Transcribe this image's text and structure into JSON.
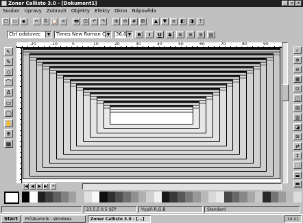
{
  "window": {
    "title": "Zoner Callisto 3.0 - [Dokument1]",
    "buttons": [
      "_",
      "▫",
      "×"
    ]
  },
  "menu": [
    "Soubor",
    "Úpravy",
    "Zobrazit",
    "Objekty",
    "Efekty",
    "Okno",
    "Nápověda"
  ],
  "toolbar": {
    "icons": [
      "new-icon",
      "open-icon",
      "save-icon",
      "cut-icon",
      "copy-icon",
      "paste-icon",
      "delete-icon",
      "print-icon",
      "preview-icon",
      "undo-icon",
      "redo-icon",
      "zoom-in-icon",
      "zoom-out-icon",
      "grid-icon",
      "snap-icon",
      "front-icon",
      "back-icon",
      "align-icon",
      "group-icon",
      "ungroup-icon",
      "help-icon"
    ],
    "glyphs": [
      "□",
      "▭",
      "▪",
      "✂",
      "⎘",
      "📋",
      "×",
      "🖶",
      "◫",
      "↶",
      "↷",
      "⊕",
      "⊖",
      "#",
      "⊞",
      "▲",
      "▼",
      "≡",
      "◧",
      "◨",
      "?"
    ]
  },
  "format": {
    "style_value": "Ctrl odstavec",
    "font_value": "Times New Roman CE",
    "size_value": "36,0",
    "bold": "B",
    "italic": "I",
    "underline": "U",
    "strike": "S"
  },
  "ruler": {
    "h_ticks": [
      "-20",
      "-10",
      "0",
      "10",
      "20",
      "30",
      "40",
      "50",
      "60",
      "70",
      "80",
      "90"
    ]
  },
  "left_tools": [
    "↖",
    "✎",
    "◇",
    "⌒",
    "A",
    "▭",
    "◯",
    "✋",
    "⊕",
    "▦"
  ],
  "right_tools": [
    "⌕",
    "⊕",
    "⊖",
    "▦",
    "⊡",
    "◫",
    "▤",
    "▥",
    "◪",
    "⊠",
    "⇄",
    "↕",
    "⬚",
    "⬓",
    "⬒"
  ],
  "page_nav": [
    "|◀",
    "◀",
    "▶",
    "▶|",
    "+"
  ],
  "status": {
    "coords": "23,5,5 0,5 SEP",
    "mode": "Vyplň R,G,B",
    "fill": "Standard"
  },
  "taskbar": {
    "start": "Start",
    "tasks": [
      "Průzkumník - Windows",
      "Zoner Callisto 3.0 - [...]"
    ],
    "clock": "14:21"
  },
  "colors": {
    "swatches": [
      "#000000",
      "#ffffff",
      "#202020",
      "#404040",
      "#606060",
      "#808080",
      "#a0a0a0",
      "#c0c0c0",
      "#e0e0e0",
      "#f8f8f8",
      "#101010",
      "#303030",
      "#505050",
      "#707070",
      "#909090",
      "#b0b0b0",
      "#d0d0d0",
      "#f0f0f0",
      "#181818",
      "#383838",
      "#585858",
      "#787878",
      "#989898",
      "#b8b8b8",
      "#d8d8d8",
      "#e8e8e8",
      "#484848",
      "#686868",
      "#888888",
      "#a8a8a8",
      "#c8c8c8",
      "#282828",
      "#747474",
      "#9c9c9c",
      "#bcbcbc",
      "#dcdcdc"
    ]
  }
}
